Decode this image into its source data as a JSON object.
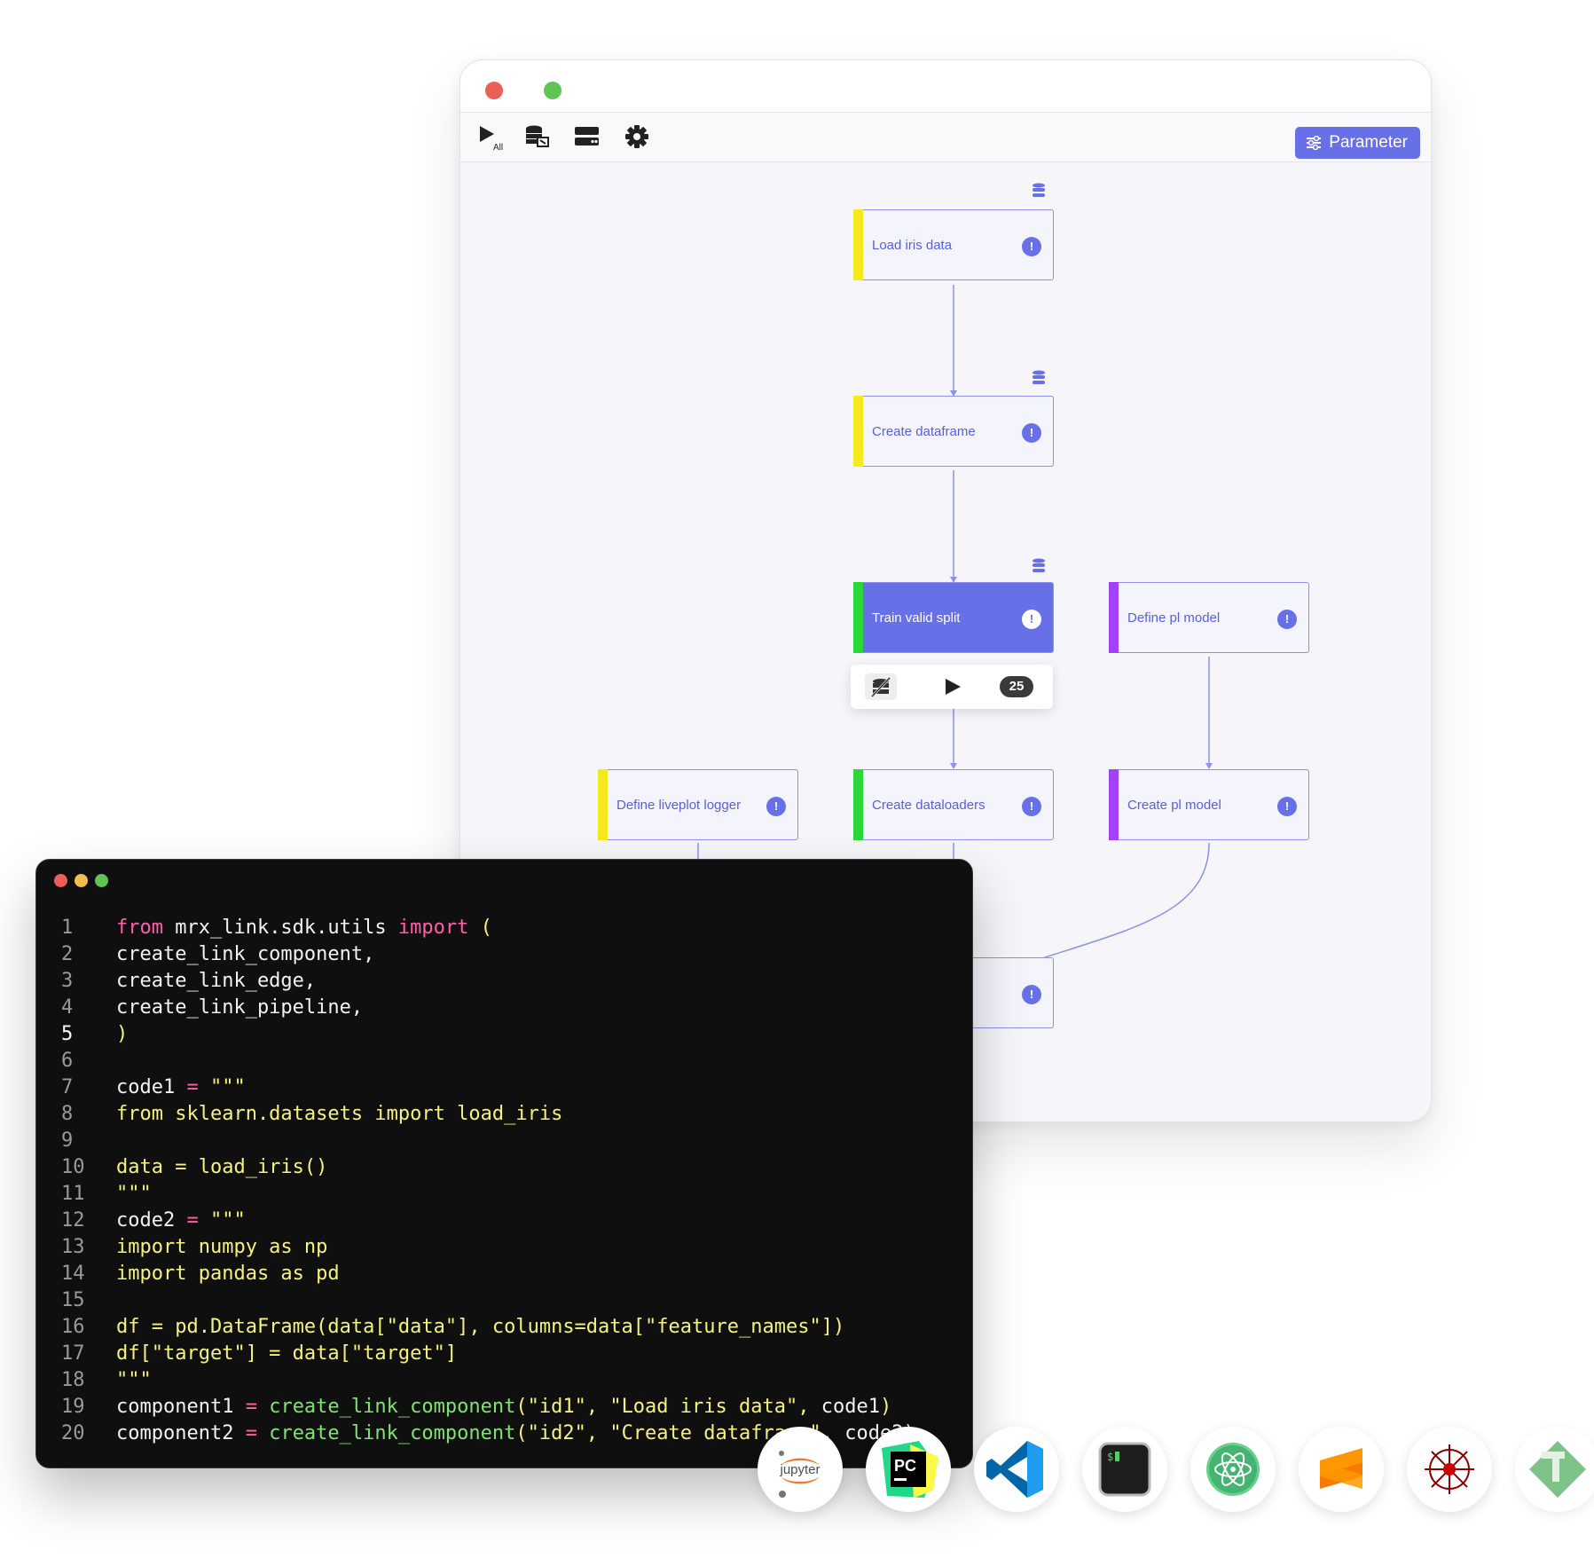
{
  "pipeline_window": {
    "toolbar": {
      "run_all_label": "All",
      "parameter_button": "Parameter"
    },
    "nodes": [
      {
        "label": "Load iris data",
        "info": "!",
        "status_color": "#f5ea1c",
        "active": false
      },
      {
        "label": "Create dataframe",
        "info": "!",
        "status_color": "#f5ea1c",
        "active": false
      },
      {
        "label": "Train valid split",
        "info": "!",
        "status_color": "#29d93a",
        "active": true
      },
      {
        "label": "Define pl model",
        "info": "!",
        "status_color": "#a342f5",
        "active": false
      },
      {
        "label": "Define liveplot logger",
        "info": "!",
        "status_color": "#f5ea1c",
        "active": false
      },
      {
        "label": "Create dataloaders",
        "info": "!",
        "status_color": "#29d93a",
        "active": false
      },
      {
        "label": "Create pl model",
        "info": "!",
        "status_color": "#a342f5",
        "active": false
      },
      {
        "label": "",
        "info": "!",
        "status_color": "#29d93a",
        "active": false
      }
    ],
    "run_bar": {
      "count": "25"
    },
    "colors": {
      "accent": "#6770e6",
      "edge": "#8b91ec"
    }
  },
  "code_window": {
    "lines": [
      {
        "n": "1",
        "tokens": [
          [
            "k",
            "from"
          ],
          [
            "w",
            " mrx_link.sdk.utils "
          ],
          [
            "k",
            "import"
          ],
          [
            "s",
            " ("
          ]
        ]
      },
      {
        "n": "2",
        "tokens": [
          [
            "w",
            "create_link_component,"
          ]
        ]
      },
      {
        "n": "3",
        "tokens": [
          [
            "w",
            "create_link_edge,"
          ]
        ]
      },
      {
        "n": "4",
        "tokens": [
          [
            "w",
            "create_link_pipeline,"
          ]
        ]
      },
      {
        "n": "5",
        "tokens": [
          [
            "s",
            ")"
          ]
        ]
      },
      {
        "n": "6",
        "tokens": []
      },
      {
        "n": "7",
        "tokens": [
          [
            "w",
            "code1 "
          ],
          [
            "k",
            "="
          ],
          [
            "s",
            " \"\"\""
          ]
        ]
      },
      {
        "n": "8",
        "tokens": [
          [
            "s",
            "from sklearn.datasets import load_iris"
          ]
        ]
      },
      {
        "n": "9",
        "tokens": []
      },
      {
        "n": "10",
        "tokens": [
          [
            "s",
            "data = load_iris()"
          ]
        ]
      },
      {
        "n": "11",
        "tokens": [
          [
            "s",
            "\"\"\""
          ]
        ]
      },
      {
        "n": "12",
        "tokens": [
          [
            "w",
            "code2 "
          ],
          [
            "k",
            "="
          ],
          [
            "s",
            " \"\"\""
          ]
        ]
      },
      {
        "n": "13",
        "tokens": [
          [
            "s",
            "import numpy as np"
          ]
        ]
      },
      {
        "n": "14",
        "tokens": [
          [
            "s",
            "import pandas as pd"
          ]
        ]
      },
      {
        "n": "15",
        "tokens": []
      },
      {
        "n": "16",
        "tokens": [
          [
            "s",
            "df = pd.DataFrame(data[\"data\"], columns=data[\"feature_names\"])"
          ]
        ]
      },
      {
        "n": "17",
        "tokens": [
          [
            "s",
            "df[\"target\"] = data[\"target\"]"
          ]
        ]
      },
      {
        "n": "18",
        "tokens": [
          [
            "s",
            "\"\"\""
          ]
        ]
      },
      {
        "n": "19",
        "tokens": [
          [
            "w",
            "component1 "
          ],
          [
            "k",
            "="
          ],
          [
            "f",
            " create_link_component"
          ],
          [
            "s",
            "(\"id1\", \"Load iris data\", "
          ],
          [
            "w",
            "code1"
          ],
          [
            "s",
            ")"
          ]
        ]
      },
      {
        "n": "20",
        "tokens": [
          [
            "w",
            "component2 "
          ],
          [
            "k",
            "="
          ],
          [
            "f",
            " create_link_component"
          ],
          [
            "s",
            "(\"id2\", \"Create dataframe\", "
          ],
          [
            "w",
            "code2"
          ],
          [
            "s",
            ")"
          ]
        ]
      }
    ],
    "current_line": "5"
  },
  "dock": {
    "apps": [
      {
        "name": "jupyter",
        "label": "jupyter"
      },
      {
        "name": "pycharm",
        "label": "PC"
      },
      {
        "name": "vscode",
        "label": ""
      },
      {
        "name": "terminal",
        "label": "$"
      },
      {
        "name": "atom",
        "label": ""
      },
      {
        "name": "sublime",
        "label": ""
      },
      {
        "name": "spyder",
        "label": ""
      },
      {
        "name": "vim",
        "label": ""
      }
    ]
  }
}
